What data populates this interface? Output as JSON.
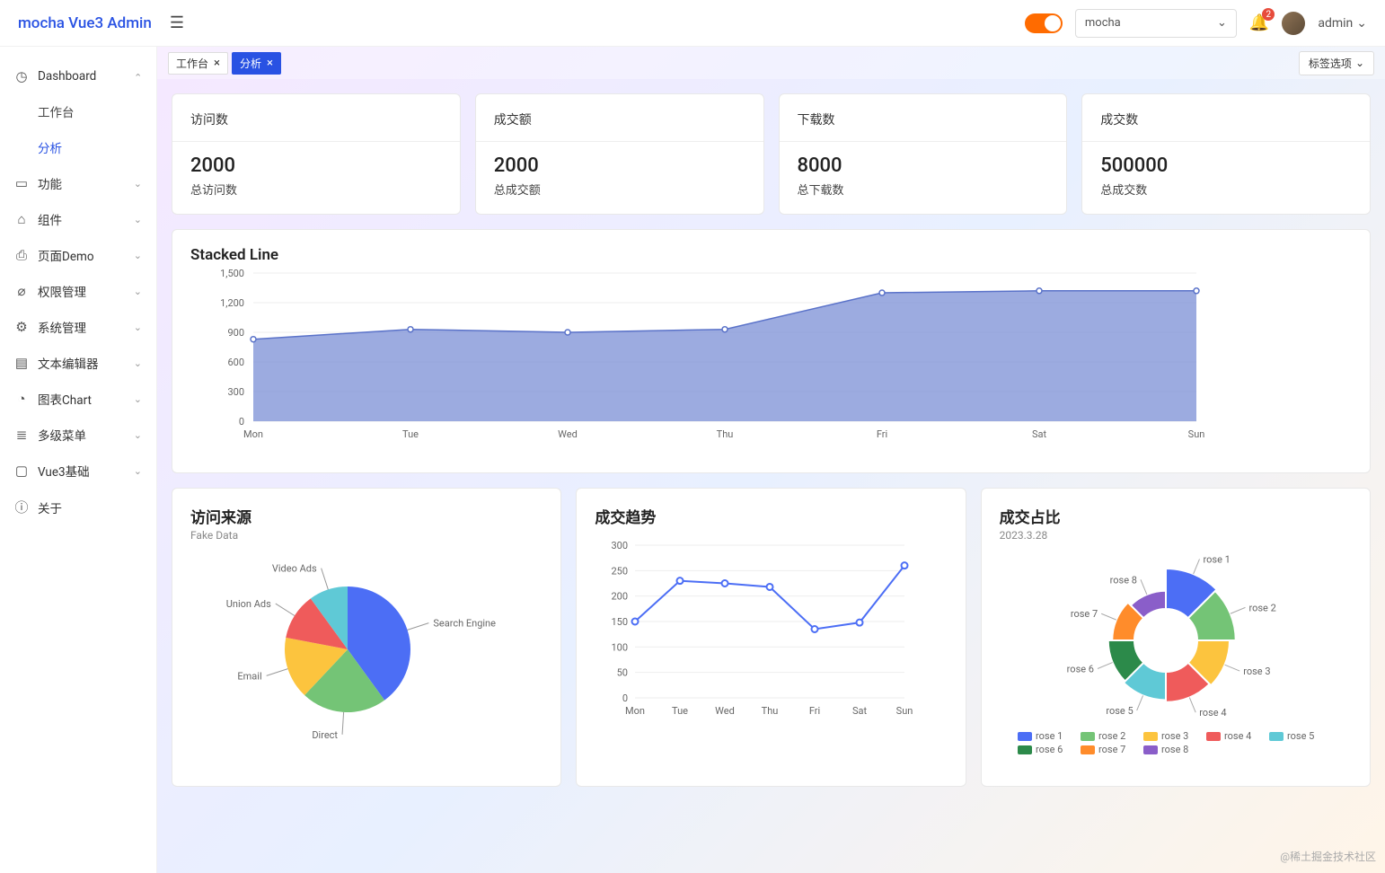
{
  "header": {
    "logo": "mocha Vue3 Admin",
    "selectValue": "mocha",
    "badge": "2",
    "userName": "admin"
  },
  "sidebar": {
    "items": [
      {
        "icon": "◷",
        "label": "Dashboard",
        "expanded": true
      },
      {
        "label": "工作台",
        "sub": true
      },
      {
        "label": "分析",
        "sub": true,
        "active": true
      },
      {
        "icon": "▭",
        "label": "功能",
        "expand": true
      },
      {
        "icon": "⌂",
        "label": "组件",
        "expand": true
      },
      {
        "icon": "⎙",
        "label": "页面Demo",
        "expand": true
      },
      {
        "icon": "⌀",
        "label": "权限管理",
        "expand": true
      },
      {
        "icon": "⚙",
        "label": "系统管理",
        "expand": true
      },
      {
        "icon": "▤",
        "label": "文本编辑器",
        "expand": true
      },
      {
        "icon": "◔",
        "label": "图表Chart",
        "expand": true
      },
      {
        "icon": "≣",
        "label": "多级菜单",
        "expand": true
      },
      {
        "icon": "▢",
        "label": "Vue3基础",
        "expand": true
      },
      {
        "icon": "ⓘ",
        "label": "关于"
      }
    ]
  },
  "tabs": {
    "items": [
      {
        "label": "工作台",
        "active": false
      },
      {
        "label": "分析",
        "active": true
      }
    ],
    "optionsLabel": "标签选项"
  },
  "stats": [
    {
      "title": "访问数",
      "value": "2000",
      "sub": "总访问数"
    },
    {
      "title": "成交额",
      "value": "2000",
      "sub": "总成交额"
    },
    {
      "title": "下载数",
      "value": "8000",
      "sub": "总下载数"
    },
    {
      "title": "成交数",
      "value": "500000",
      "sub": "总成交数"
    }
  ],
  "chart_data": [
    {
      "type": "area",
      "title": "Stacked Line",
      "categories": [
        "Mon",
        "Tue",
        "Wed",
        "Thu",
        "Fri",
        "Sat",
        "Sun"
      ],
      "values": [
        830,
        930,
        900,
        930,
        1300,
        1320,
        1320
      ],
      "ylim": [
        0,
        1500
      ],
      "yticks": [
        0,
        300,
        600,
        900,
        1200,
        1500
      ]
    },
    {
      "type": "pie",
      "title": "访问来源",
      "subtitle": "Fake Data",
      "series": [
        {
          "name": "Search Engine",
          "value": 40,
          "color": "#4c6ef5"
        },
        {
          "name": "Direct",
          "value": 22,
          "color": "#74c476"
        },
        {
          "name": "Email",
          "value": 16,
          "color": "#fcc43e"
        },
        {
          "name": "Union Ads",
          "value": 12,
          "color": "#ef5b5b"
        },
        {
          "name": "Video Ads",
          "value": 10,
          "color": "#5fc9d6"
        }
      ]
    },
    {
      "type": "line",
      "title": "成交趋势",
      "categories": [
        "Mon",
        "Tue",
        "Wed",
        "Thu",
        "Fri",
        "Sat",
        "Sun"
      ],
      "values": [
        150,
        230,
        225,
        218,
        135,
        148,
        260
      ],
      "ylim": [
        0,
        300
      ],
      "yticks": [
        0,
        50,
        100,
        150,
        200,
        250,
        300
      ]
    },
    {
      "type": "pie",
      "title": "成交占比",
      "subtitle": "2023.3.28",
      "series": [
        {
          "name": "rose 1",
          "value": 40,
          "color": "#4c6ef5"
        },
        {
          "name": "rose 2",
          "value": 38,
          "color": "#74c476"
        },
        {
          "name": "rose 3",
          "value": 32,
          "color": "#fcc43e"
        },
        {
          "name": "rose 4",
          "value": 30,
          "color": "#ef5b5b"
        },
        {
          "name": "rose 5",
          "value": 28,
          "color": "#5fc9d6"
        },
        {
          "name": "rose 6",
          "value": 26,
          "color": "#2c8a4a"
        },
        {
          "name": "rose 7",
          "value": 22,
          "color": "#ff8c2b"
        },
        {
          "name": "rose 8",
          "value": 18,
          "color": "#8a5ec9"
        }
      ],
      "legend": [
        "rose 1",
        "rose 2",
        "rose 3",
        "rose 4",
        "rose 5",
        "rose 6",
        "rose 7",
        "rose 8"
      ]
    }
  ],
  "watermark": "@稀土掘金技术社区"
}
